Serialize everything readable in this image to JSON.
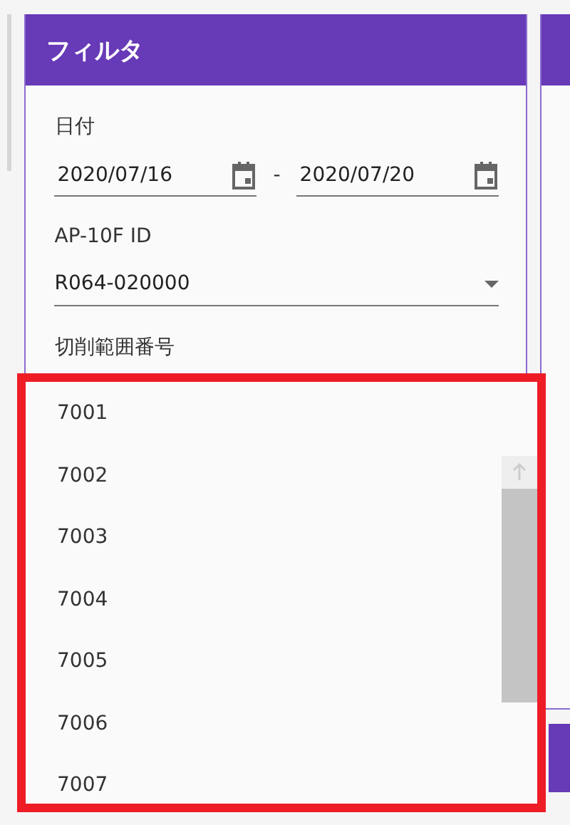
{
  "filter_panel": {
    "title": "フィルタ",
    "date": {
      "label": "日付",
      "from": "2020/07/16",
      "separator": "-",
      "to": "2020/07/20"
    },
    "device": {
      "label": "AP-10F ID",
      "value": "R064-020000"
    },
    "range": {
      "label": "切削範囲番号"
    }
  },
  "dropdown": {
    "options": [
      "7001",
      "7002",
      "7003",
      "7004",
      "7005",
      "7006",
      "7007"
    ]
  }
}
